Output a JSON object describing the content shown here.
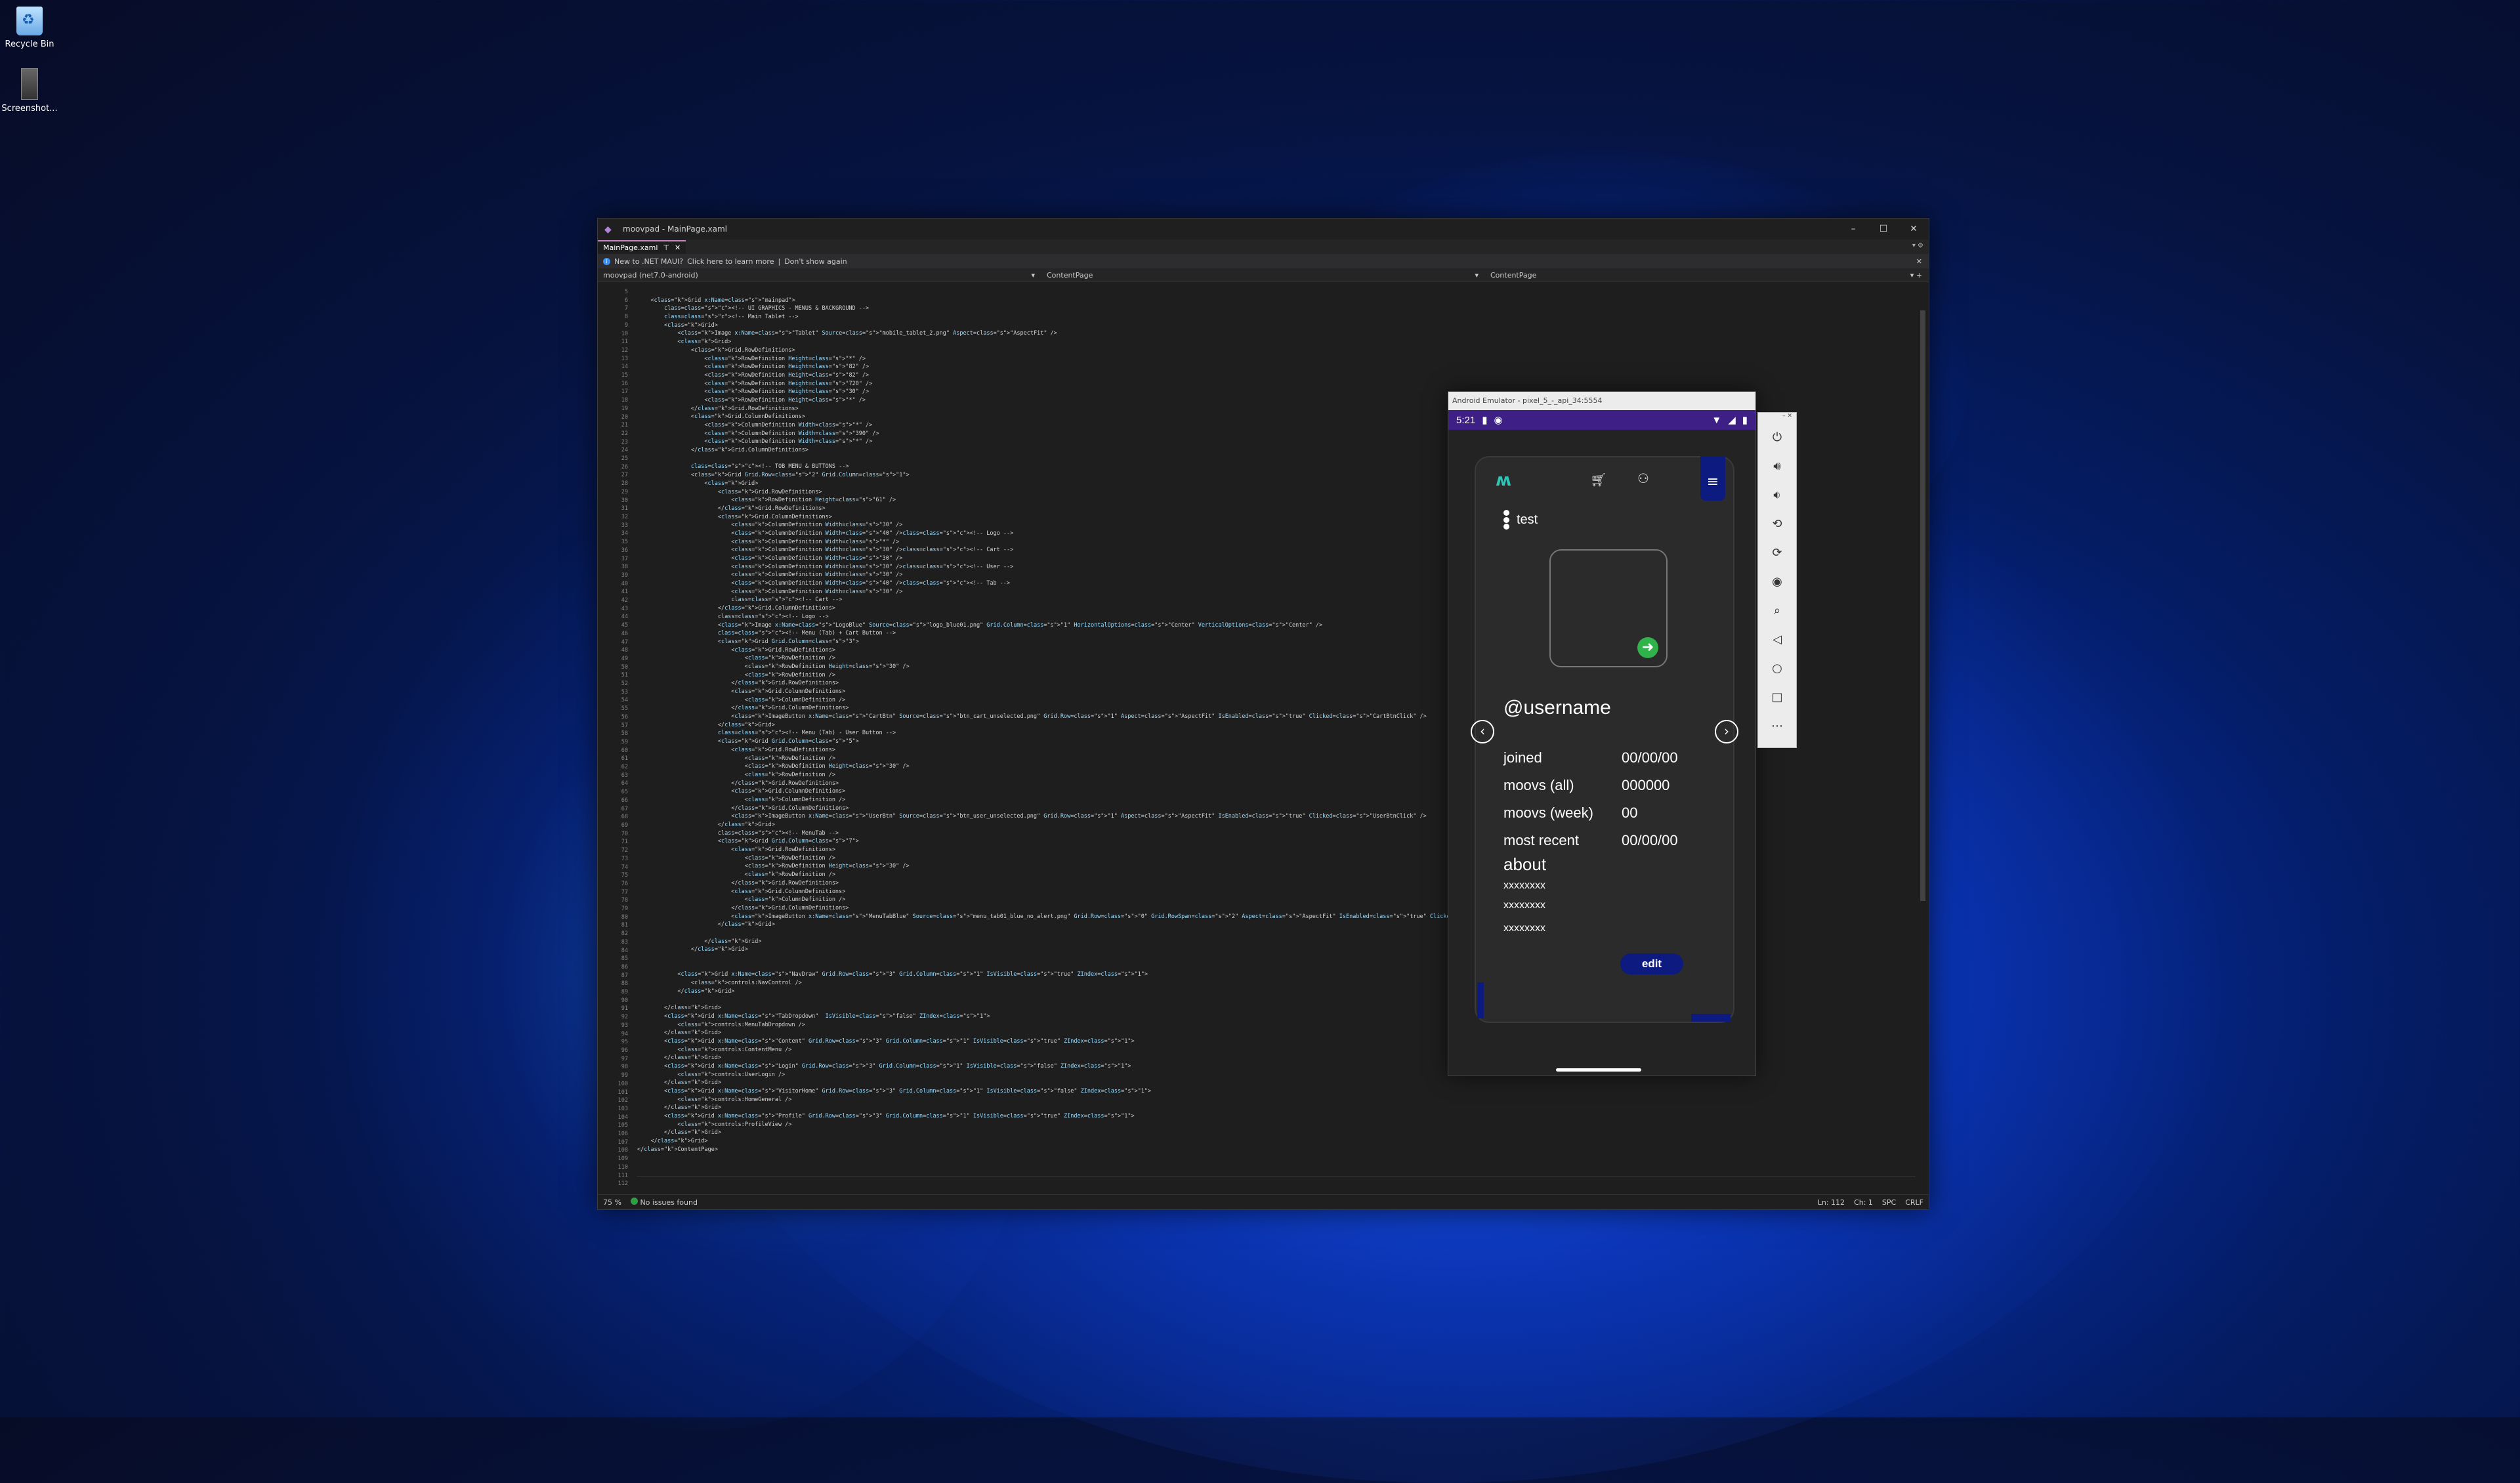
{
  "desktop": {
    "icons": [
      {
        "label": "Recycle Bin",
        "icon": "recycle-bin-icon"
      },
      {
        "label": "Screenshot...",
        "icon": "image-file-icon"
      }
    ]
  },
  "vs": {
    "title": "moovpad - MainPage.xaml",
    "tab_label": "MainPage.xaml",
    "info_text": "New to .NET MAUI?",
    "info_link": "Click here to learn more",
    "info_dismiss": "Don't show again",
    "nav_project": "moovpad (net7.0-android)",
    "nav_type1": "ContentPage",
    "nav_type2": "ContentPage",
    "status_zoom": "75 %",
    "status_issues": "No issues found",
    "status_ln": "Ln: 112",
    "status_ch": "Ch: 1",
    "status_spc": "SPC",
    "status_crlf": "CRLF",
    "line_numbers": [
      "5",
      "6",
      "7",
      "8",
      "9",
      "10",
      "11",
      "12",
      "13",
      "14",
      "15",
      "16",
      "17",
      "18",
      "19",
      "20",
      "21",
      "22",
      "23",
      "24",
      "25",
      "26",
      "27",
      "28",
      "29",
      "30",
      "31",
      "32",
      "33",
      "34",
      "35",
      "36",
      "37",
      "38",
      "39",
      "40",
      "41",
      "42",
      "43",
      "44",
      "45",
      "46",
      "47",
      "48",
      "49",
      "50",
      "51",
      "52",
      "53",
      "54",
      "55",
      "56",
      "57",
      "58",
      "59",
      "60",
      "61",
      "62",
      "63",
      "64",
      "65",
      "66",
      "67",
      "68",
      "69",
      "70",
      "71",
      "72",
      "73",
      "74",
      "75",
      "76",
      "77",
      "78",
      "79",
      "80",
      "81",
      "82",
      "83",
      "84",
      "85",
      "86",
      "87",
      "88",
      "89",
      "90",
      "91",
      "92",
      "93",
      "94",
      "95",
      "96",
      "97",
      "98",
      "99",
      "100",
      "101",
      "102",
      "103",
      "104",
      "105",
      "106",
      "107",
      "108",
      "109",
      "110",
      "111",
      "112"
    ],
    "code_lines": [
      "",
      "    <Grid x:Name=\"mainpad\">",
      "        <!-- UI GRAPHICS - MENUS & BACKGROUND -->",
      "        <!-- Main Tablet -->",
      "        <Grid>",
      "            <Image x:Name=\"Tablet\" Source=\"mobile_tablet_2.png\" Aspect=\"AspectFit\" />",
      "            <Grid>",
      "                <Grid.RowDefinitions>",
      "                    <RowDefinition Height=\"*\" />",
      "                    <RowDefinition Height=\"82\" />",
      "                    <RowDefinition Height=\"82\" />",
      "                    <RowDefinition Height=\"720\" />",
      "                    <RowDefinition Height=\"30\" />",
      "                    <RowDefinition Height=\"*\" />",
      "                </Grid.RowDefinitions>",
      "                <Grid.ColumnDefinitions>",
      "                    <ColumnDefinition Width=\"*\" />",
      "                    <ColumnDefinition Width=\"390\" />",
      "                    <ColumnDefinition Width=\"*\" />",
      "                </Grid.ColumnDefinitions>",
      "",
      "                <!-- TOB MENU & BUTTONS -->",
      "                <Grid Grid.Row=\"2\" Grid.Column=\"1\">",
      "                    <Grid>",
      "                        <Grid.RowDefinitions>",
      "                            <RowDefinition Height=\"61\" />",
      "                        </Grid.RowDefinitions>",
      "                        <Grid.ColumnDefinitions>",
      "                            <ColumnDefinition Width=\"30\" />",
      "                            <ColumnDefinition Width=\"40\" /><!-- Logo -->",
      "                            <ColumnDefinition Width=\"*\" />",
      "                            <ColumnDefinition Width=\"30\" /><!-- Cart -->",
      "                            <ColumnDefinition Width=\"30\" />",
      "                            <ColumnDefinition Width=\"30\" /><!-- User -->",
      "                            <ColumnDefinition Width=\"30\" />",
      "                            <ColumnDefinition Width=\"40\" /><!-- Tab -->",
      "                            <ColumnDefinition Width=\"30\" />",
      "                            <!-- Cart -->",
      "                        </Grid.ColumnDefinitions>",
      "                        <!-- Logo -->",
      "                        <Image x:Name=\"LogoBlue\" Source=\"logo_blue01.png\" Grid.Column=\"1\" HorizontalOptions=\"Center\" VerticalOptions=\"Center\" />",
      "                        <!-- Menu (Tab) + Cart Button -->",
      "                        <Grid Grid.Column=\"3\">",
      "                            <Grid.RowDefinitions>",
      "                                <RowDefinition />",
      "                                <RowDefinition Height=\"30\" />",
      "                                <RowDefinition />",
      "                            </Grid.RowDefinitions>",
      "                            <Grid.ColumnDefinitions>",
      "                                <ColumnDefinition />",
      "                            </Grid.ColumnDefinitions>",
      "                            <ImageButton x:Name=\"CartBtn\" Source=\"btn_cart_unselected.png\" Grid.Row=\"1\" Aspect=\"AspectFit\" IsEnabled=\"true\" Clicked=\"CartBtnClick\" />",
      "                        </Grid>",
      "                        <!-- Menu (Tab) - User Button -->",
      "                        <Grid Grid.Column=\"5\">",
      "                            <Grid.RowDefinitions>",
      "                                <RowDefinition />",
      "                                <RowDefinition Height=\"30\" />",
      "                                <RowDefinition />",
      "                            </Grid.RowDefinitions>",
      "                            <Grid.ColumnDefinitions>",
      "                                <ColumnDefinition />",
      "                            </Grid.ColumnDefinitions>",
      "                            <ImageButton x:Name=\"UserBtn\" Source=\"btn_user_unselected.png\" Grid.Row=\"1\" Aspect=\"AspectFit\" IsEnabled=\"true\" Clicked=\"UserBtnClick\" />",
      "                        </Grid>",
      "                        <!-- MenuTab -->",
      "                        <Grid Grid.Column=\"7\">",
      "                            <Grid.RowDefinitions>",
      "                                <RowDefinition />",
      "                                <RowDefinition Height=\"30\" />",
      "                                <RowDefinition />",
      "                            </Grid.RowDefinitions>",
      "                            <Grid.ColumnDefinitions>",
      "                                <ColumnDefinition />",
      "                            </Grid.ColumnDefinitions>",
      "                            <ImageButton x:Name=\"MenuTabBlue\" Source=\"menu_tab01_blue_no_alert.png\" Grid.Row=\"0\" Grid.RowSpan=\"2\" Aspect=\"AspectFit\" IsEnabled=\"true\" Clicked=\"MenuTabClick\" />",
      "                        </Grid>",
      "",
      "                    </Grid>",
      "                </Grid>",
      "",
      "",
      "            <Grid x:Name=\"NavDraw\" Grid.Row=\"3\" Grid.Column=\"1\" IsVisible=\"true\" ZIndex=\"1\">",
      "                <controls:NavControl />",
      "            </Grid>",
      "",
      "        </Grid>",
      "        <Grid x:Name=\"TabDropdown\"  IsVisible=\"false\" ZIndex=\"1\">",
      "            <controls:MenuTabDropdown />",
      "        </Grid>",
      "        <Grid x:Name=\"Content\" Grid.Row=\"3\" Grid.Column=\"1\" IsVisible=\"true\" ZIndex=\"1\">",
      "            <controls:ContentMenu />",
      "        </Grid>",
      "        <Grid x:Name=\"Login\" Grid.Row=\"3\" Grid.Column=\"1\" IsVisible=\"false\" ZIndex=\"1\">",
      "            <controls:UserLogin />",
      "        </Grid>",
      "        <Grid x:Name=\"VisitorHome\" Grid.Row=\"3\" Grid.Column=\"1\" IsVisible=\"false\" ZIndex=\"1\">",
      "            <controls:HomeGeneral />",
      "        </Grid>",
      "        <Grid x:Name=\"Profile\" Grid.Row=\"3\" Grid.Column=\"1\" IsVisible=\"true\" ZIndex=\"1\">",
      "            <controls:ProfileView />",
      "        </Grid>",
      "    </Grid>",
      "</ContentPage>",
      ""
    ]
  },
  "emulator": {
    "title": "Android Emulator - pixel_5_-_api_34:5554",
    "time": "5:21",
    "app": {
      "username_label": "test",
      "handle": "@username",
      "stats": [
        {
          "label": "joined",
          "value": "00/00/00"
        },
        {
          "label": "moovs (all)",
          "value": "000000"
        },
        {
          "label": "moovs (week)",
          "value": "00"
        },
        {
          "label": "most recent",
          "value": "00/00/00"
        }
      ],
      "about_title": "about",
      "about_lines": [
        "xxxxxxxx",
        "xxxxxxxx",
        "xxxxxxxx"
      ],
      "edit_label": "edit",
      "colors": {
        "accent": "#0d1a80",
        "status_bar": "#3d1f86",
        "go_button": "#2fb34a",
        "logo": "#2ec4b6"
      }
    },
    "side_controls": [
      "power-icon",
      "volume-up-icon",
      "volume-down-icon",
      "rotate-left-icon",
      "rotate-right-icon",
      "camera-icon",
      "zoom-icon",
      "back-icon",
      "home-icon",
      "overview-icon",
      "more-icon"
    ]
  }
}
